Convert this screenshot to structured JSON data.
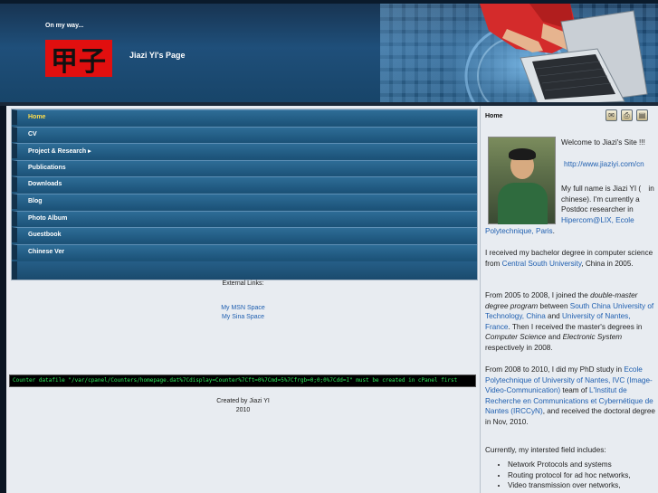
{
  "header": {
    "tagline": "On my way...",
    "logo_text": "甲子",
    "site_title": "Jiazi YI's Page"
  },
  "menu": {
    "items": [
      {
        "label": "Home",
        "active": true
      },
      {
        "label": "CV"
      },
      {
        "label": "Project & Research ▸"
      },
      {
        "label": "Publications"
      },
      {
        "label": "Downloads"
      },
      {
        "label": "Blog"
      },
      {
        "label": "Photo Album"
      },
      {
        "label": "Guestbook"
      },
      {
        "label": "Chinese Ver"
      }
    ]
  },
  "external_links": {
    "title": "External Links:",
    "links": [
      "My MSN Space",
      "My Sina Space"
    ]
  },
  "counter_text": "Counter datafile \"/var/cpanel/Counters/homepage.dat%7Cdisplay=Counter%7Cft=0%7Cmd=5%7Cfrgb=0;0;0%7Cdd=I\" must be created in cPanel first",
  "credit": {
    "line1": "Created by Jiazi YI",
    "line2": "2010"
  },
  "content": {
    "title": "Home",
    "icons": [
      "email-icon",
      "print-icon",
      "save-icon"
    ],
    "welcome": "Welcome to Jiazi's Site !!!",
    "site_url": "http://www.jiaziyi.com/cn",
    "p1_a": "My full name is Jiazi YI (",
    "p1_b": "in chinese). I'm currently a Postdoc researcher in",
    "p1_link1": "Hipercom@LIX, Ecole Polytechnique, Paris",
    "p2_a": "I received my bachelor degree in computer science from",
    "p2_link": "Central South University",
    "p2_b": ", China in 2005.",
    "p3_a": "From 2005 to 2008, I joined the",
    "p3_em": "double-master degree program",
    "p3_b": "between",
    "p3_link1": "South China University of Technology, China",
    "p3_c": "and",
    "p3_link2": "University of Nantes, France",
    "p3_d": ". Then I received the master's degrees in",
    "p3_em2": "Computer Science",
    "p3_e": "and",
    "p3_em3": "Electronic System",
    "p3_f": "respectively in 2008.",
    "p4_a": "From 2008 to 2010, I did my PhD study in",
    "p4_link1": "Ecole Polytechnique of University of Nantes, IVC (Image-Video-Communication)",
    "p4_b": "team of",
    "p4_link2": "L'Institut de Recherche en Communications et Cybernétique de Nantes (IRCCyN)",
    "p4_c": ", and received the doctoral degree in Nov, 2010.",
    "p5": "Currently, my intersted field includes:",
    "interests": [
      "Network Protocols and systems",
      "Routing protocol for ad hoc networks,",
      "Video transmission over networks,"
    ]
  },
  "colors": {
    "header_blue": "#1f4f7a",
    "menu_blue": "#1d5378",
    "active_menu_text": "#ffde4c",
    "link_blue": "#1f5fb0",
    "counter_green": "#2ee85a",
    "logo_red": "#e10f0f"
  }
}
